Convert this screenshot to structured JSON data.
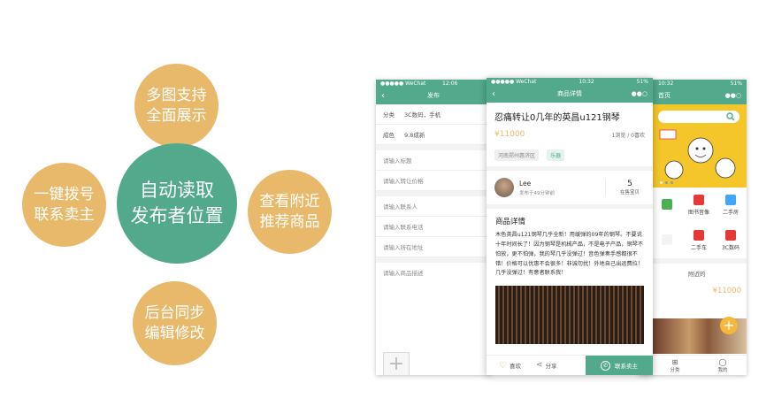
{
  "features": {
    "top": [
      "多图支持",
      "全面展示"
    ],
    "left": [
      "一键拨号",
      "联系卖主"
    ],
    "center": [
      "自动读取",
      "发布者位置"
    ],
    "right": [
      "查看附近",
      "推荐商品"
    ],
    "bottom": [
      "后台同步",
      "编辑修改"
    ]
  },
  "colors": {
    "accent": "#52a98b",
    "secondary": "#e8b96a",
    "price": "#e8b96a"
  },
  "phone1": {
    "status": {
      "carrier": "●●●●● WeChat",
      "time": "12:06"
    },
    "nav_title": "发布",
    "category": {
      "label": "分类",
      "value": "3C数码，手机"
    },
    "condition": {
      "label": "成色",
      "value": "9.8成新"
    },
    "title_placeholder": "请输入标题",
    "price_placeholder": "请输入转让价格",
    "contact_placeholder": "请输入联系人",
    "phone_placeholder": "请输入联系电话",
    "address_placeholder": "请输入所在地址",
    "desc_placeholder": "请输入商品描述"
  },
  "phone2": {
    "status": {
      "carrier": "●●●●● WeChat",
      "time": "10:32",
      "battery": "51%"
    },
    "nav_title": "商品详情",
    "item_title": "忍痛转让0几年的英昌u121钢琴",
    "price": "¥11000",
    "stats": "1浏览 / 0喜欢",
    "location_tag": "河南郑州惠济区",
    "category_tag": "乐器",
    "seller": {
      "name": "Lee",
      "posted": "发布于49分钟前",
      "count": "5",
      "count_label": "在售宝贝"
    },
    "detail_heading": "商品详情",
    "description": "木色英昌u121钢琴几乎全新！用缓弹的09年的钢琴。不要说十年时间长了！因为钢琴是机械产品，不是电子产品，钢琴不怕放，更不怕弹，我的琴几乎没弹过！音色弹奏手感都很不错！价格可以优惠不会很多！非诚勿扰！外地自己出运费拉！几乎没弹过！有意者联系我！",
    "like_label": "喜欢",
    "share_label": "分享",
    "contact_label": "联系卖主"
  },
  "phone3": {
    "status": {
      "time": "10:32",
      "battery": "51%"
    },
    "nav_title": "首页",
    "grid": [
      {
        "label": "",
        "icon": "phone-icon",
        "color": "#4caf50"
      },
      {
        "label": "图书音像",
        "icon": "location-icon",
        "color": "#e53935"
      },
      {
        "label": "二手房",
        "icon": "book-icon",
        "color": "#42a5f5"
      },
      {
        "label": "",
        "icon": "car-icon",
        "color": "#f3f3f3"
      },
      {
        "label": "二手车",
        "icon": "car-icon",
        "color": "#e53935"
      },
      {
        "label": "3C数码",
        "icon": "bag-icon",
        "color": "#e53935"
      }
    ],
    "nearby_label": "附近的",
    "price": "¥11000",
    "tab_category": "分类",
    "tab_mine": "我的"
  }
}
